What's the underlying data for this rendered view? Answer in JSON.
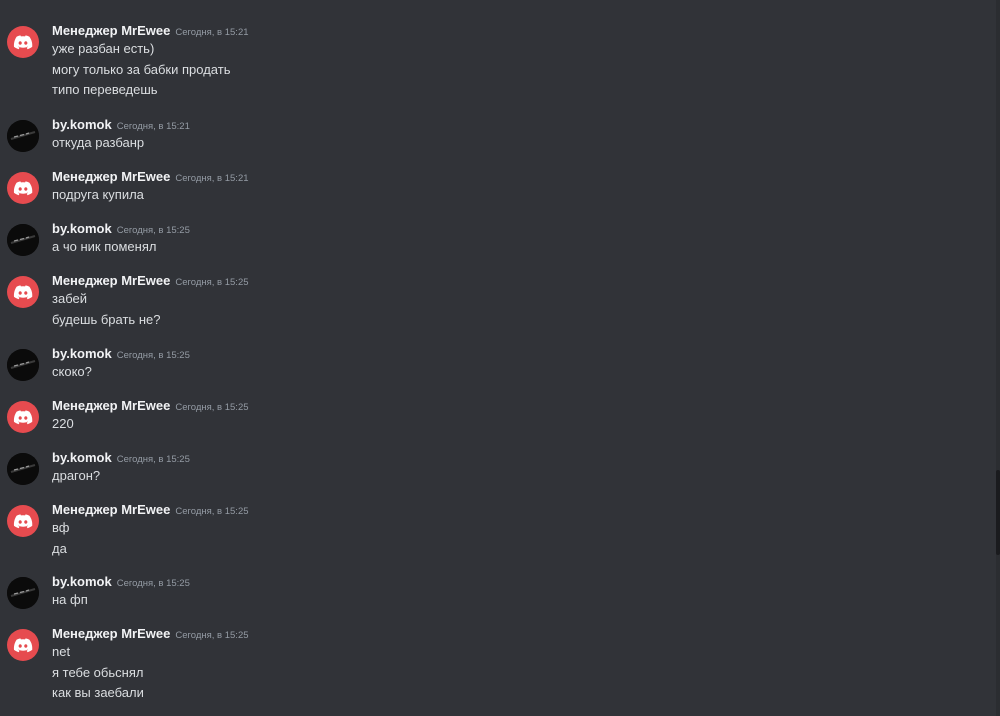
{
  "users": {
    "bot": {
      "name": "Менеджер MrEwee",
      "avatar": "discord-logo-icon",
      "color": "#e64b4f"
    },
    "user": {
      "name": "by.komok",
      "avatar": "dark-profile-avatar"
    }
  },
  "messages": [
    {
      "author": "Менеджер MrEwee",
      "time": "Сегодня, в 15:21",
      "lines": [
        "уже разбан есть)",
        "могу только за бабки продать",
        "типо переведешь"
      ]
    },
    {
      "author": "by.komok",
      "time": "Сегодня, в 15:21",
      "lines": [
        "откуда разбанр"
      ]
    },
    {
      "author": "Менеджер MrEwee",
      "time": "Сегодня, в 15:21",
      "lines": [
        "подруга купила"
      ]
    },
    {
      "author": "by.komok",
      "time": "Сегодня, в 15:25",
      "lines": [
        "а чо ник поменял"
      ]
    },
    {
      "author": "Менеджер MrEwee",
      "time": "Сегодня, в 15:25",
      "lines": [
        "забей",
        "будешь брать не?"
      ]
    },
    {
      "author": "by.komok",
      "time": "Сегодня, в 15:25",
      "lines": [
        "скоко?"
      ]
    },
    {
      "author": "Менеджер MrEwee",
      "time": "Сегодня, в 15:25",
      "lines": [
        "220"
      ]
    },
    {
      "author": "by.komok",
      "time": "Сегодня, в 15:25",
      "lines": [
        "драгон?"
      ]
    },
    {
      "author": "Менеджер MrEwee",
      "time": "Сегодня, в 15:25",
      "lines": [
        "вф",
        "да"
      ]
    },
    {
      "author": "by.komok",
      "time": "Сегодня, в 15:25",
      "lines": [
        "на фп"
      ]
    },
    {
      "author": "Менеджер MrEwee",
      "time": "Сегодня, в 15:25",
      "lines": [
        "net",
        "я тебе обьснял",
        "как вы заебали"
      ]
    }
  ]
}
